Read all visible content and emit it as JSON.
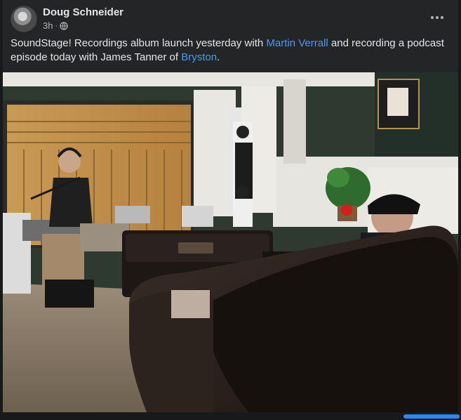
{
  "post": {
    "author": "Doug Schneider",
    "time": "3h",
    "separator": "·",
    "privacy_icon": "globe-icon",
    "more_icon": "more-options-icon",
    "text_part1": "SoundStage! Recordings album launch yesterday with ",
    "mention1": "Martin Verrall",
    "text_part2": " and recording a podcast episode today with James Tanner of ",
    "mention2": "Bryston",
    "text_part3": "."
  },
  "colors": {
    "background": "#18191a",
    "card": "#242526",
    "text": "#e4e6eb",
    "secondary": "#b0b3b8",
    "link": "#4599ff"
  }
}
